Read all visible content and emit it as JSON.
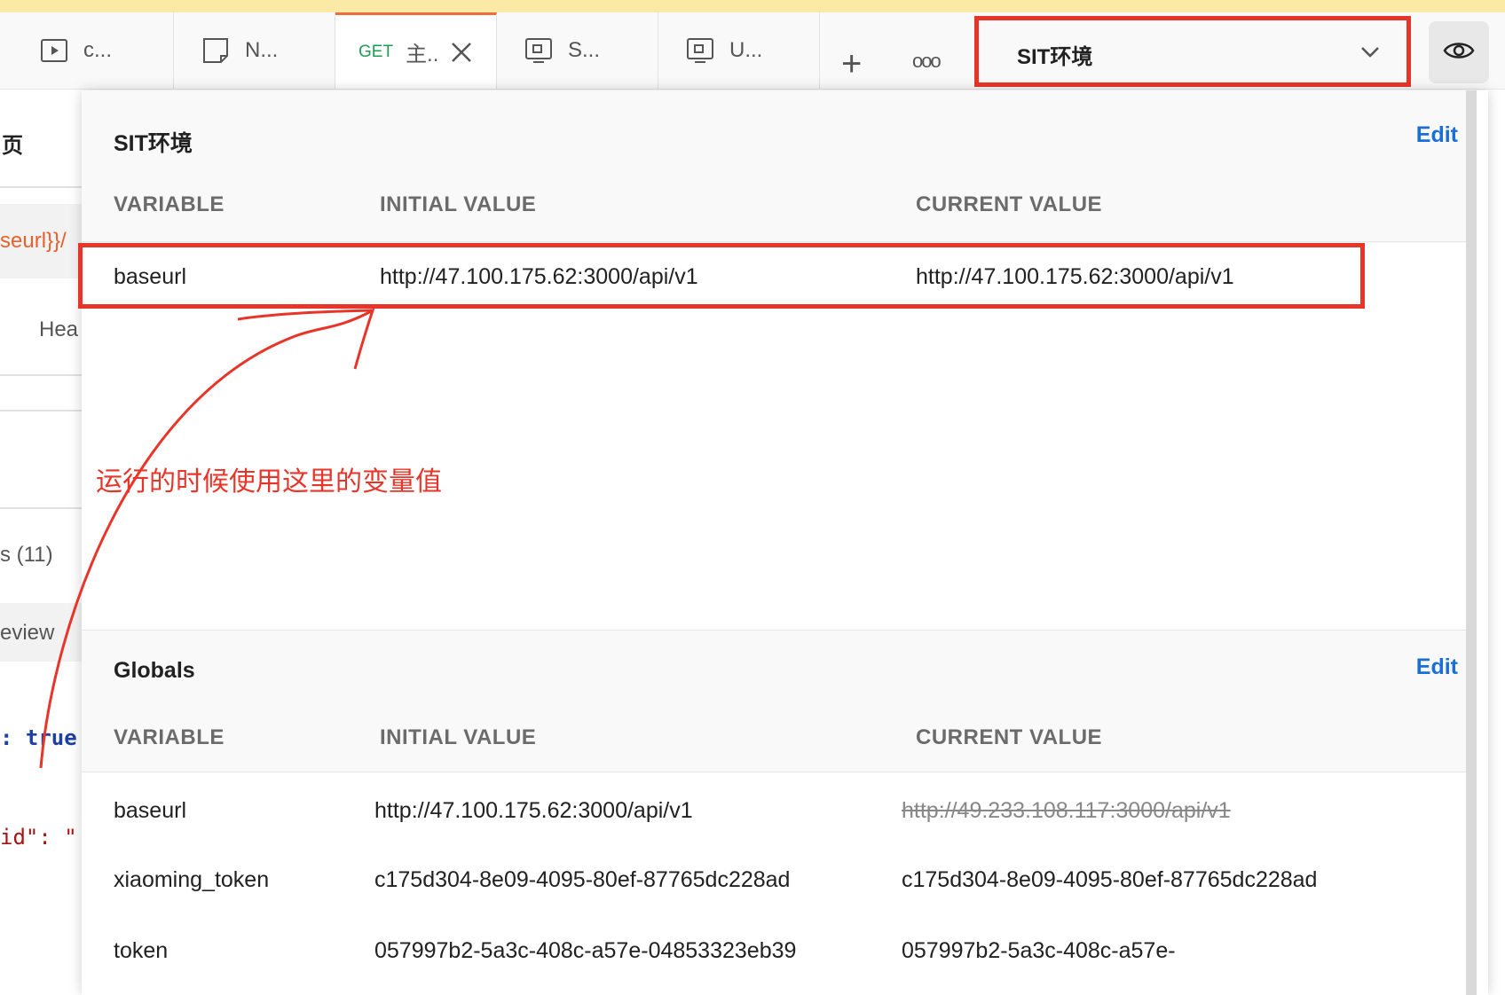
{
  "tabs": [
    {
      "label": "c...",
      "icon": "play-icon"
    },
    {
      "label": "N...",
      "icon": "note-icon"
    },
    {
      "method": "GET",
      "label": "主..",
      "icon": "close-icon",
      "active": true
    },
    {
      "label": "S...",
      "icon": "monitor-icon"
    },
    {
      "label": "U...",
      "icon": "monitor-icon"
    }
  ],
  "toolbar": {
    "add": "+",
    "more": "ooo"
  },
  "environment": {
    "selected": "SIT环境"
  },
  "background": {
    "title_fragment": "页",
    "url_fragment": "seurl}}/",
    "headers_fragment": "Hea",
    "count_fragment": "s (11)",
    "preview_fragment": "eview",
    "code_true": ": true",
    "code_id": "id\": \""
  },
  "popover": {
    "env_section": {
      "title": "SIT环境",
      "edit": "Edit",
      "columns": [
        "VARIABLE",
        "INITIAL VALUE",
        "CURRENT VALUE"
      ],
      "rows": [
        {
          "variable": "baseurl",
          "initial": "http://47.100.175.62:3000/api/v1",
          "current": "http://47.100.175.62:3000/api/v1"
        }
      ]
    },
    "globals_section": {
      "title": "Globals",
      "edit": "Edit",
      "columns": [
        "VARIABLE",
        "INITIAL VALUE",
        "CURRENT VALUE"
      ],
      "rows": [
        {
          "variable": "baseurl",
          "initial": "http://47.100.175.62:3000/api/v1",
          "current": "http://49.233.108.117:3000/api/v1"
        },
        {
          "variable": "xiaoming_token",
          "initial": "c175d304-8e09-4095-80ef-87765dc228ad",
          "current": "c175d304-8e09-4095-80ef-87765dc228ad"
        },
        {
          "variable": "token",
          "initial": "057997b2-5a3c-408c-a57e-04853323eb39",
          "current": "057997b2-5a3c-408c-a57e-"
        }
      ]
    }
  },
  "annotation": {
    "text": "运行的时候使用这里的变量值",
    "color": "#e8352a"
  },
  "colors": {
    "accent": "#1a6ed8",
    "annotation": "#e8352a",
    "get_method": "#1f9d55"
  }
}
